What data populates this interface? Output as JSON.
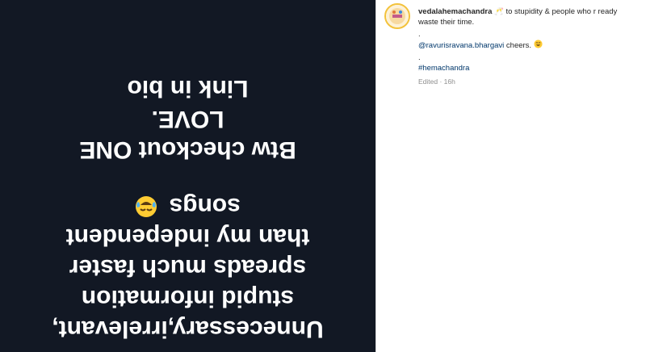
{
  "post": {
    "image_text": {
      "lines": [
        "Unnecessary,irrelevant,",
        "stupid information",
        "spreads much faster",
        "than my independent",
        "songs",
        "Btw checkout ONE",
        "LOVE.",
        "Link in bio"
      ],
      "emoji_icon": "face-with-tears-of-joy-emoji"
    },
    "caption": {
      "username": "vedalahemachandra",
      "text_line1": " 🥂 to stupidity & people who r ready waste their time.",
      "dot1": ".",
      "mention": "@ravurisravana.bhargavi",
      "mention_suffix": " cheers.",
      "dot2": ".",
      "hashtag": "#hemachandra"
    },
    "meta": {
      "edited": "Edited",
      "separator": " · ",
      "time": "16h"
    },
    "colors": {
      "image_bg": "#121824",
      "image_text": "#ffffff",
      "link": "#00376b",
      "meta": "#8e8e8e"
    }
  }
}
